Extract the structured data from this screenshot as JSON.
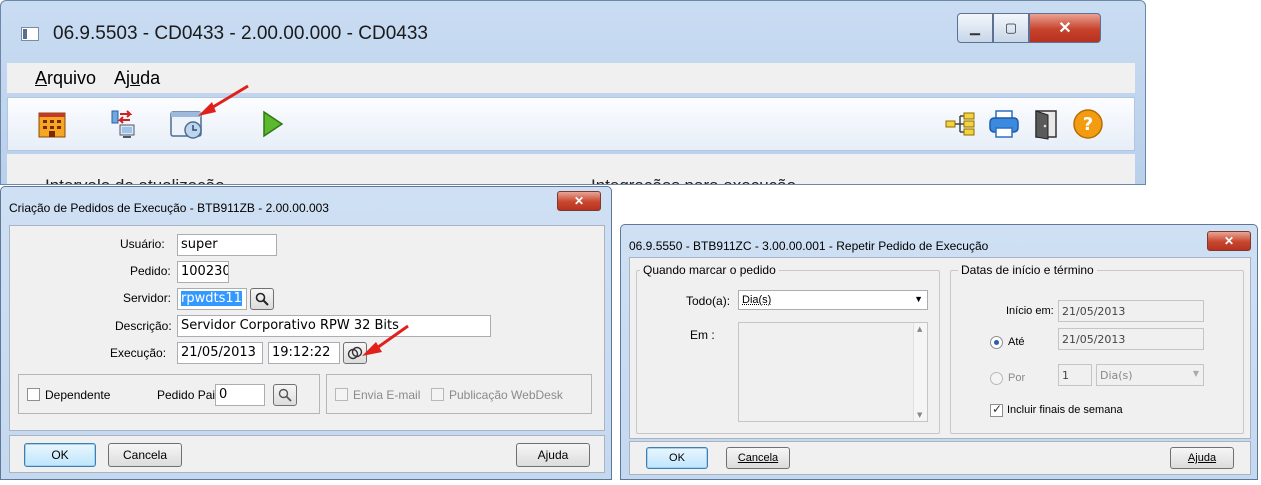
{
  "main_window": {
    "title": "06.9.5503 - CD0433 - 2.00.00.000 - CD0433",
    "menu": [
      {
        "label": "Arquivo",
        "accel": "A",
        "rest": "rquivo"
      },
      {
        "label": "Ajuda",
        "pre": "Aj",
        "accel": "u",
        "rest": "da"
      }
    ],
    "toolbar_left_icons": [
      "building-icon",
      "transfer-computer-icon",
      "scheduler-icon",
      "play-icon"
    ],
    "toolbar_right_icons": [
      "tree-icon",
      "printer-icon",
      "exit-door-icon",
      "help-icon"
    ],
    "group_left": "Intervalo de atualização",
    "group_right": "Integrações para execução"
  },
  "dialog1": {
    "title": "Criação de Pedidos de Execução - BTB911ZB - 2.00.00.003",
    "usuario_label": "Usuário:",
    "usuario_value": "super",
    "pedido_label": "Pedido:",
    "pedido_value": "100230",
    "servidor_label": "Servidor:",
    "servidor_value": "rpwdts11",
    "descricao_label": "Descrição:",
    "descricao_value": "Servidor Corporativo RPW 32 Bits",
    "execucao_label": "Execução:",
    "execucao_date": "21/05/2013",
    "execucao_time": "19:12:22",
    "dependente_label": "Dependente",
    "pedido_pai_label": "Pedido Pai:",
    "pedido_pai_value": "0",
    "envia_email_label": "Envia E-mail",
    "publicacao_label": "Publicação WebDesk",
    "ok_label": "OK",
    "cancela_label": "Cancela",
    "ajuda_label": "Ajuda"
  },
  "dialog2": {
    "title": "06.9.5550 - BTB911ZC - 3.00.00.001 - Repetir Pedido de Execução",
    "group_left_title": "Quando marcar o pedido",
    "todo_label": "Todo(a):",
    "todo_value": "Dia(s)",
    "em_label": "Em :",
    "group_right_title": "Datas de início e término",
    "inicio_label": "Início em:",
    "inicio_value": "21/05/2013",
    "ate_label": "Até",
    "ate_value": "21/05/2013",
    "por_label": "Por",
    "por_value": "1",
    "por_unit": "Dia(s)",
    "incluir_label": "Incluir finais de semana",
    "ok_label": "OK",
    "cancela_label": "Cancela",
    "ajuda_label": "Ajuda"
  },
  "colors": {
    "window_chrome": "#c4d8f0",
    "close_red": "#c7432b",
    "arrow_red": "#e0201a",
    "selection_blue": "#3399ff"
  }
}
